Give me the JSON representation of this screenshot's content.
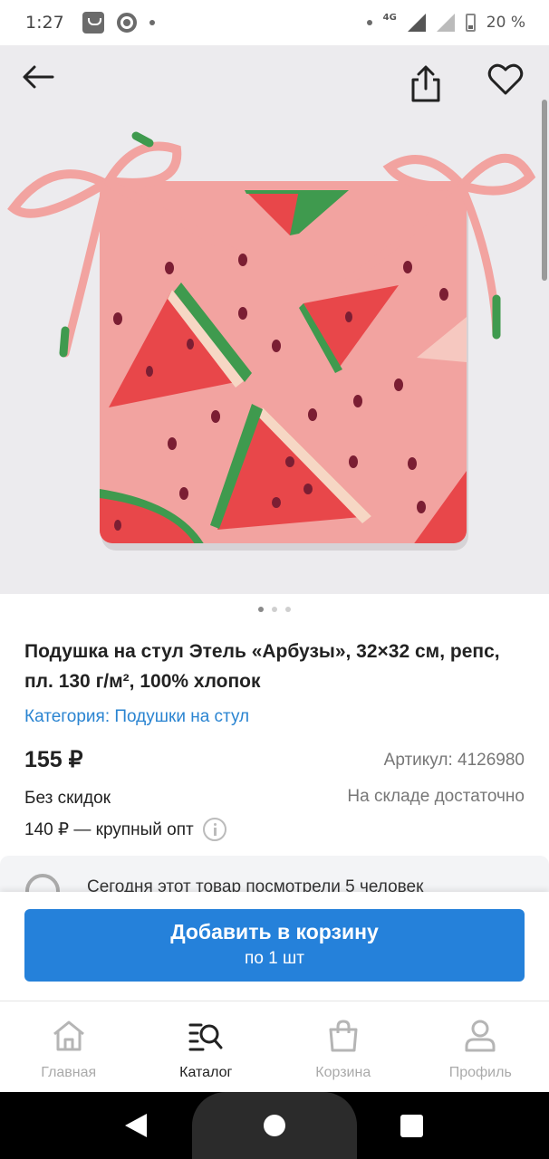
{
  "status_bar": {
    "time": "1:27",
    "network": "4G",
    "battery": "20 %"
  },
  "product": {
    "title": "Подушка на стул Этель «Арбузы», 32×32 см, репс, пл. 130 г/м², 100% хлопок",
    "category": "Категория: Подушки на стул",
    "price": "155 ₽",
    "article": "Артикул: 4126980",
    "discount": "Без скидок",
    "stock": "На складе достаточно",
    "wholesale": "140 ₽ — крупный опт",
    "images_total": 3,
    "image_active": 1
  },
  "viewed_banner": {
    "text": "Сегодня этот товар посмотрели 5 человек"
  },
  "cart": {
    "button_label": "Добавить в корзину",
    "button_sub": "по 1 шт"
  },
  "bottom_nav": {
    "items": [
      {
        "label": "Главная",
        "icon": "home-icon"
      },
      {
        "label": "Каталог",
        "icon": "catalog-search-icon"
      },
      {
        "label": "Корзина",
        "icon": "bag-icon"
      },
      {
        "label": "Профиль",
        "icon": "profile-icon"
      }
    ],
    "active_index": 1
  },
  "colors": {
    "accent": "#2581da",
    "link": "#2a84d1",
    "cushion": "#f2a3a0",
    "watermelon_red": "#e8474a",
    "rind_green": "#3f9a4e"
  }
}
